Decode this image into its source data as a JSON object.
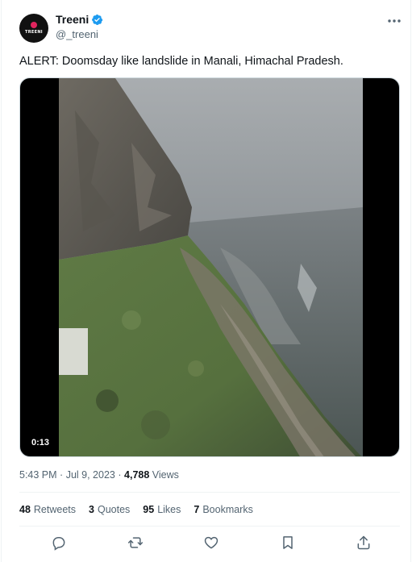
{
  "author": {
    "display_name": "Treeni",
    "handle": "@_treeni",
    "avatar_text": "TREENI",
    "avatar_icon": "red-dot-logo"
  },
  "tweet": {
    "text": "ALERT: Doomsday like landslide in Manali, Himachal Pradesh.",
    "video_duration": "0:13",
    "time": "5:43 PM",
    "separator": "·",
    "date": "Jul 9, 2023",
    "views_count": "4,788",
    "views_label": "Views"
  },
  "stats": {
    "retweets": {
      "count": "48",
      "label": "Retweets"
    },
    "quotes": {
      "count": "3",
      "label": "Quotes"
    },
    "likes": {
      "count": "95",
      "label": "Likes"
    },
    "bookmarks": {
      "count": "7",
      "label": "Bookmarks"
    }
  },
  "icons": {
    "more": "more-horizontal-icon",
    "verified": "verified-badge-icon",
    "reply": "reply-icon",
    "retweet": "retweet-icon",
    "like": "heart-icon",
    "bookmark": "bookmark-icon",
    "share": "share-icon"
  },
  "colors": {
    "verified_blue": "#1d9bf0",
    "text_primary": "#0f1419",
    "text_secondary": "#536471",
    "divider": "#eff3f4"
  }
}
